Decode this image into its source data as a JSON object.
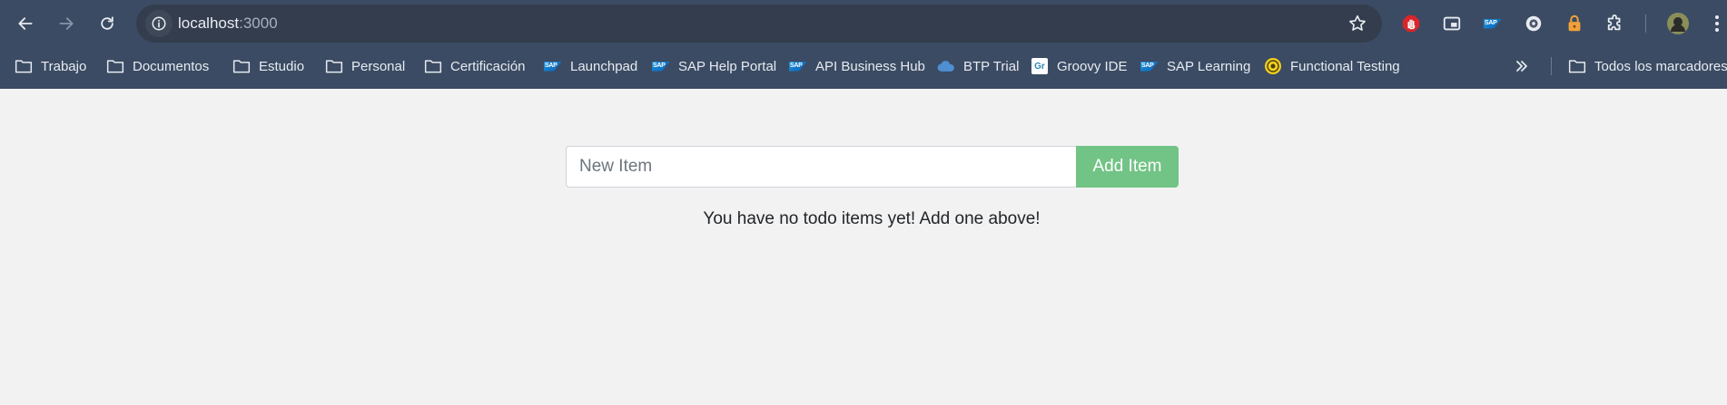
{
  "browser": {
    "url_host": "localhost",
    "url_port": ":3000",
    "bookmarks": [
      {
        "label": "Trabajo",
        "icon": "folder-icon"
      },
      {
        "label": "Documentos",
        "icon": "folder-icon"
      },
      {
        "label": "Estudio",
        "icon": "folder-icon"
      },
      {
        "label": "Personal",
        "icon": "folder-icon"
      },
      {
        "label": "Certificación",
        "icon": "folder-icon"
      },
      {
        "label": "Launchpad",
        "icon": "sap-icon"
      },
      {
        "label": "SAP Help Portal",
        "icon": "sap-icon"
      },
      {
        "label": "API Business Hub",
        "icon": "sap-icon"
      },
      {
        "label": "BTP Trial",
        "icon": "cloud-icon"
      },
      {
        "label": "Groovy IDE",
        "icon": "groovy-icon"
      },
      {
        "label": "SAP Learning",
        "icon": "sap-icon"
      },
      {
        "label": "Functional Testing",
        "icon": "target-icon"
      }
    ],
    "all_bookmarks_label": "Todos los marcadores",
    "sap_logo_text": "SAP",
    "groovy_logo_text": "Gr",
    "colors": {
      "chrome": "#3b4b63",
      "omnibox": "#333d4d"
    }
  },
  "todo": {
    "input_placeholder": "New Item",
    "input_value": "",
    "add_button_label": "Add Item",
    "empty_message": "You have no todo items yet! Add one above!",
    "colors": {
      "add_button": "#72c386",
      "background": "#f2f2f2"
    }
  }
}
